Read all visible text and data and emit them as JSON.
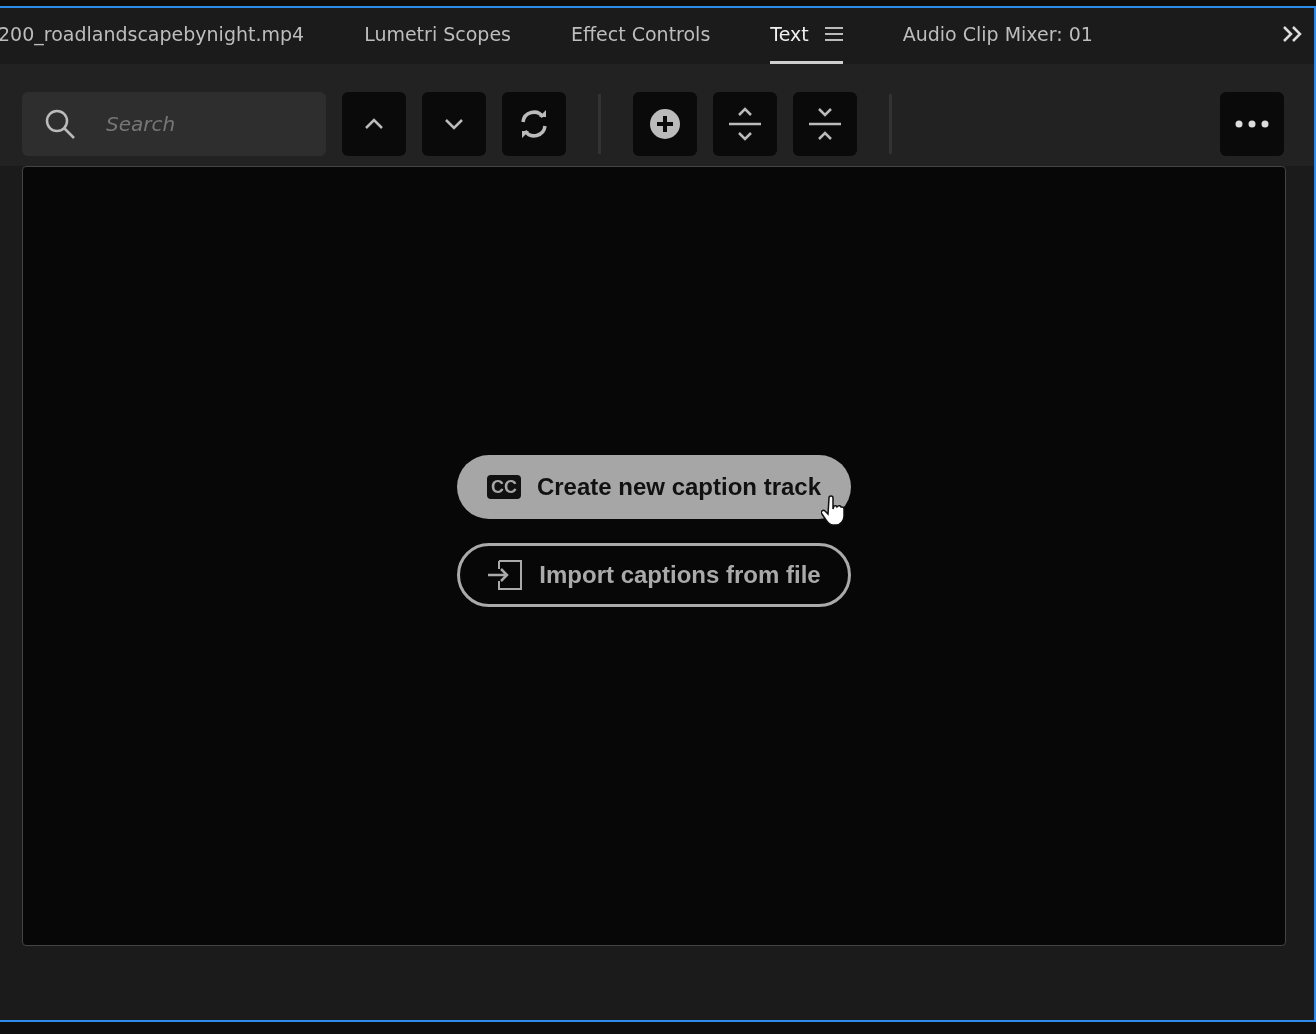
{
  "tabs": [
    {
      "label": "200_roadlandscapebynight.mp4",
      "selected": false
    },
    {
      "label": "Lumetri Scopes",
      "selected": false
    },
    {
      "label": "Effect Controls",
      "selected": false
    },
    {
      "label": "Text",
      "selected": true
    },
    {
      "label": "Audio Clip Mixer: 01",
      "selected": false
    }
  ],
  "search": {
    "placeholder": "Search"
  },
  "actions": [
    {
      "kind": "badge",
      "badge": "CC",
      "label": "Create new caption track",
      "hovered": true
    },
    {
      "kind": "import",
      "label": "Import captions from file",
      "hovered": false
    }
  ]
}
